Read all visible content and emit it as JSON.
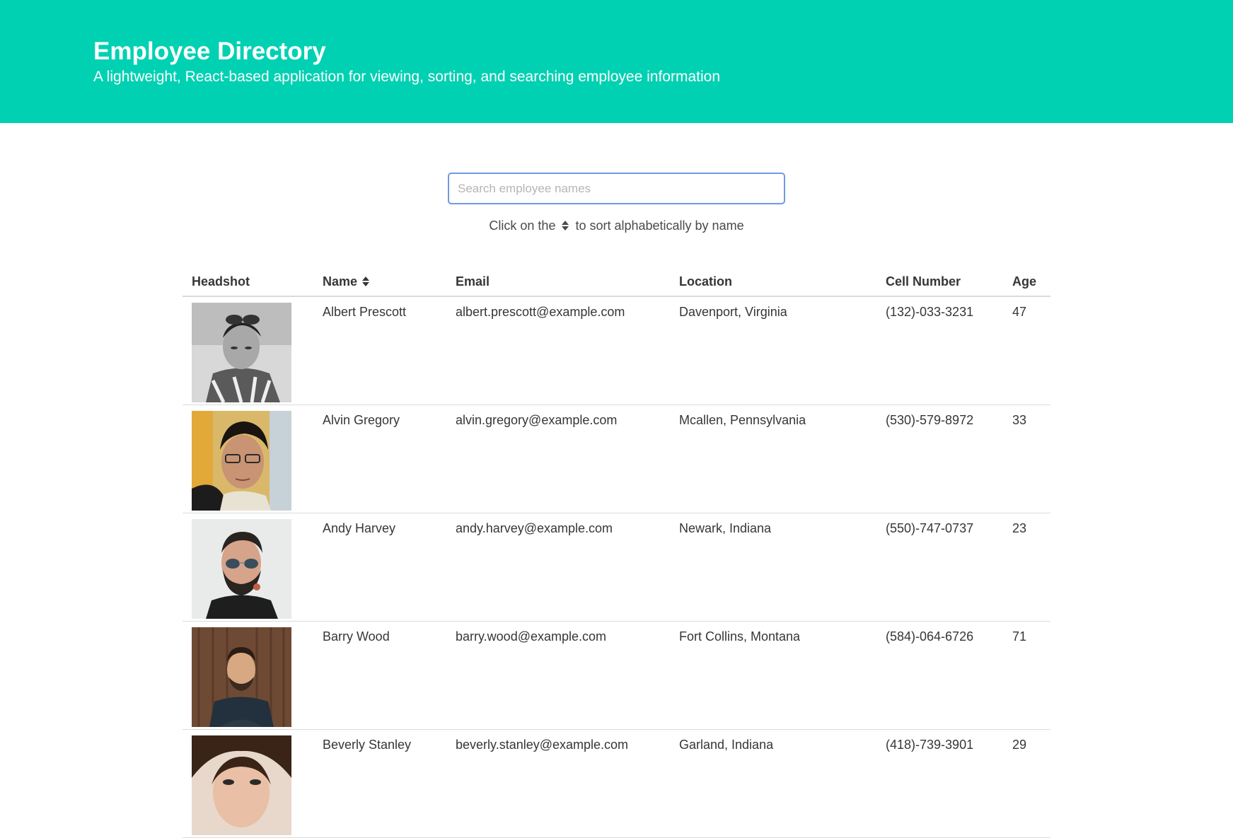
{
  "header": {
    "title": "Employee Directory",
    "subtitle": "A lightweight, React-based application for viewing, sorting, and searching employee information",
    "accent_color": "#00d1b2"
  },
  "search": {
    "placeholder": "Search employee names",
    "value": ""
  },
  "hint": {
    "before": "Click on the",
    "icon": "sort-icon",
    "after": "to sort alphabetically by name"
  },
  "table": {
    "columns": [
      "Headshot",
      "Name",
      "Email",
      "Location",
      "Cell Number",
      "Age"
    ],
    "rows": [
      {
        "name": "Albert Prescott",
        "email": "albert.prescott@example.com",
        "location": "Davenport, Virginia",
        "cell": "(132)-033-3231",
        "age": "47",
        "photo": "headshot-man-sunglasses-on-head-bw"
      },
      {
        "name": "Alvin Gregory",
        "email": "alvin.gregory@example.com",
        "location": "Mcallen, Pennsylvania",
        "cell": "(530)-579-8972",
        "age": "33",
        "photo": "headshot-man-glasses"
      },
      {
        "name": "Andy Harvey",
        "email": "andy.harvey@example.com",
        "location": "Newark, Indiana",
        "cell": "(550)-747-0737",
        "age": "23",
        "photo": "headshot-man-sunglasses-beard"
      },
      {
        "name": "Barry Wood",
        "email": "barry.wood@example.com",
        "location": "Fort Collins, Montana",
        "cell": "(584)-064-6726",
        "age": "71",
        "photo": "headshot-man-wood-background"
      },
      {
        "name": "Beverly Stanley",
        "email": "beverly.stanley@example.com",
        "location": "Garland, Indiana",
        "cell": "(418)-739-3901",
        "age": "29",
        "photo": "headshot-woman"
      }
    ]
  }
}
